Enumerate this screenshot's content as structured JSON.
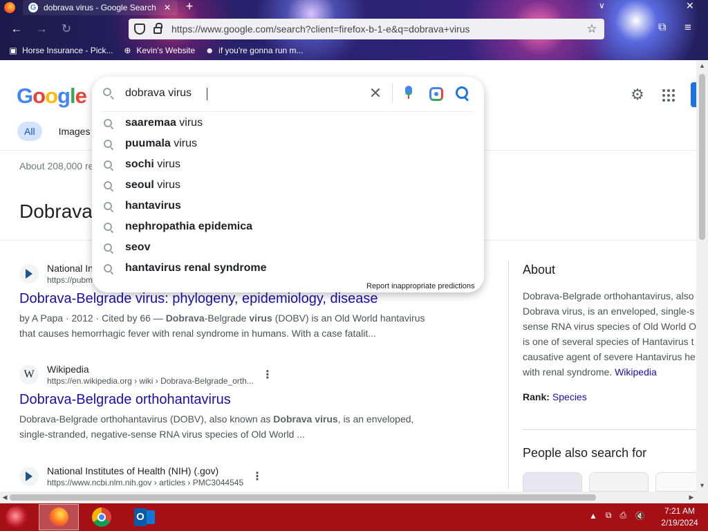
{
  "browser": {
    "tab_title": "dobrava virus - Google Search",
    "tab_favicon": "G",
    "tab_close_glyph": "✕",
    "new_tab_glyph": "+",
    "tab_list_glyph": "∨",
    "window_close_glyph": "✕",
    "back_glyph": "←",
    "forward_glyph": "→",
    "reload_glyph": "↻",
    "url": "https://www.google.com/search?client=firefox-b-1-e&q=dobrava+virus",
    "star_glyph": "☆",
    "extensions_glyph": "⧉",
    "menu_glyph": "≡",
    "bookmarks": [
      {
        "label": "Horse Insurance - Pick...",
        "icon": "horse-icon",
        "glyph": "▣"
      },
      {
        "label": "Kevin's Website",
        "icon": "globe-icon",
        "glyph": "⊕"
      },
      {
        "label": "if you're gonna run m...",
        "icon": "skull-icon",
        "glyph": "☻"
      }
    ]
  },
  "google": {
    "logo": [
      "G",
      "o",
      "o",
      "g",
      "l",
      "e"
    ],
    "settings_glyph": "⚙",
    "filters": [
      "All",
      "Images"
    ],
    "result_count": "About 208,000 re",
    "kp_title": "Dobrava",
    "search": {
      "query": "dobrava virus",
      "clear_glyph": "✕",
      "suggestions": [
        {
          "bold": "saaremaa",
          "rest": " virus"
        },
        {
          "bold": "puumala",
          "rest": " virus"
        },
        {
          "bold": "sochi",
          "rest": " virus"
        },
        {
          "bold": "seoul",
          "rest": " virus"
        },
        {
          "bold": "hantavirus",
          "rest": ""
        },
        {
          "bold": "nephropathia epidemica",
          "rest": ""
        },
        {
          "bold": "seov",
          "rest": ""
        },
        {
          "bold": "hantavirus renal syndrome",
          "rest": ""
        }
      ],
      "report": "Report inappropriate predictions"
    },
    "results": [
      {
        "source": "National In",
        "url": "https://pubm",
        "icon": "nih",
        "title": "Dobrava-Belgrade virus: phylogeny, epidemiology, disease",
        "snippet_1": "by A Papa · 2012 · Cited by 66 — ",
        "snippet_b1": "Dobrava",
        "snippet_2": "-Belgrade ",
        "snippet_b2": "virus",
        "snippet_3": " (DOBV) is an Old World hantavirus that causes hemorrhagic fever with renal syndrome in humans. With a case fatalit..."
      },
      {
        "source": "Wikipedia",
        "url": "https://en.wikipedia.org › wiki › Dobrava-Belgrade_orth...",
        "icon": "W",
        "title": "Dobrava-Belgrade orthohantavirus",
        "snippet_1": "Dobrava-Belgrade orthohantavirus (DOBV), also known as ",
        "snippet_b1": "Dobrava virus",
        "snippet_2": ", is an enveloped, single-stranded, negative-sense RNA virus species of Old World ...",
        "snippet_b2": "",
        "snippet_3": ""
      },
      {
        "source": "National Institutes of Health (NIH) (.gov)",
        "url": "https://www.ncbi.nlm.nih.gov › articles › PMC3044545",
        "icon": "nih"
      }
    ],
    "dots_glyph": "⋮",
    "about": {
      "heading": "About",
      "lines": [
        "Dobrava-Belgrade orthohantavirus, also",
        "Dobrava virus, is an enveloped, single-s",
        "sense RNA virus species of Old World O",
        "is one of several species of Hantavirus t",
        "causative agent of severe Hantavirus he"
      ],
      "last_line": "with renal syndrome. ",
      "link": "Wikipedia",
      "rank_label": "Rank:",
      "rank_value": "Species",
      "pasf": "People also search for"
    }
  },
  "taskbar": {
    "tray_up": "▲",
    "tray_icons": [
      "⧉",
      "⎙",
      "🔇"
    ],
    "time": "7:21 AM",
    "date": "2/19/2024"
  }
}
